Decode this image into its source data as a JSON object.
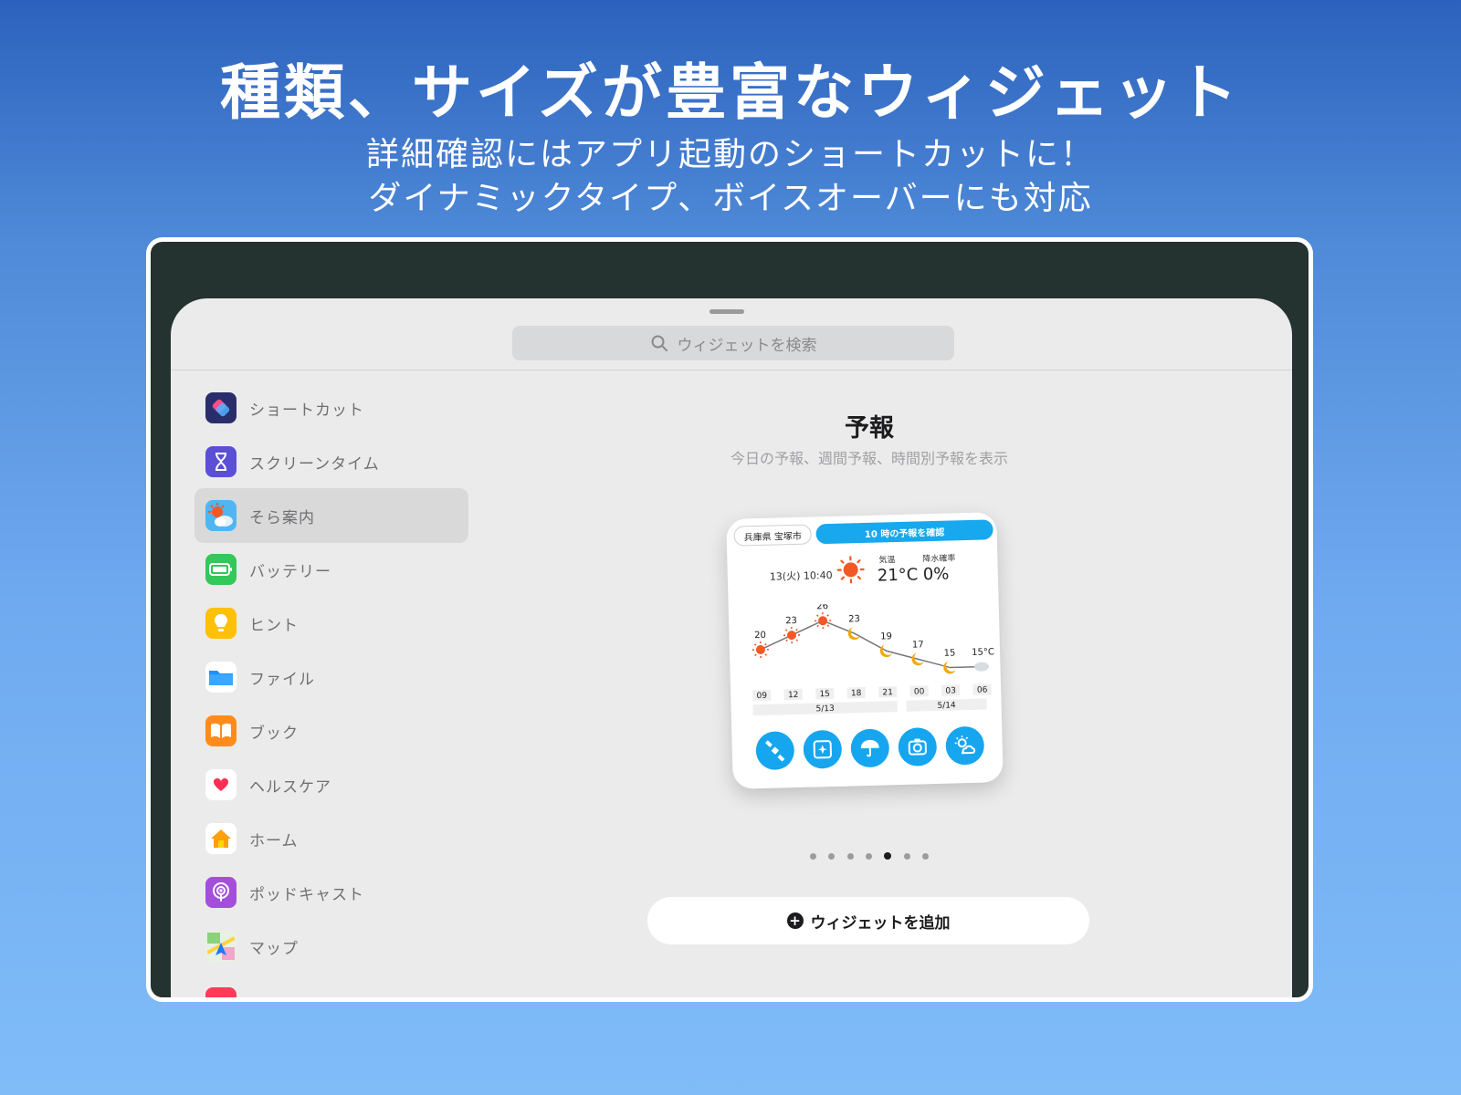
{
  "promo": {
    "headline": "種類、サイズが豊富なウィジェット",
    "subline1": "詳細確認にはアプリ起動のショートカットに！",
    "subline2": "ダイナミックタイプ、ボイスオーバーにも対応"
  },
  "search": {
    "placeholder": "ウィジェットを検索"
  },
  "sidebar": {
    "items": [
      {
        "label": "ショートカット",
        "icon": "shortcuts-icon"
      },
      {
        "label": "スクリーンタイム",
        "icon": "hourglass-icon"
      },
      {
        "label": "そら案内",
        "icon": "weather-app-icon",
        "selected": true
      },
      {
        "label": "バッテリー",
        "icon": "battery-icon"
      },
      {
        "label": "ヒント",
        "icon": "lightbulb-icon"
      },
      {
        "label": "ファイル",
        "icon": "folder-icon"
      },
      {
        "label": "ブック",
        "icon": "book-icon"
      },
      {
        "label": "ヘルスケア",
        "icon": "heart-icon"
      },
      {
        "label": "ホーム",
        "icon": "home-icon"
      },
      {
        "label": "ポッドキャスト",
        "icon": "podcast-icon"
      },
      {
        "label": "マップ",
        "icon": "maps-icon"
      }
    ]
  },
  "widget_gallery": {
    "title": "予報",
    "description": "今日の予報、週間予報、時間別予報を表示",
    "page_count": 7,
    "active_page": 5,
    "add_button": "ウィジェットを追加"
  },
  "widget": {
    "location": "兵庫県 宝塚市",
    "forecast_button": "10 時の予報を確認",
    "datetime": "13(火) 10:40",
    "temp_label": "気温",
    "temp_value": "21°C",
    "rain_label": "降水確率",
    "rain_value": "0%",
    "unit_label": "15°C",
    "hours": [
      "09",
      "12",
      "15",
      "18",
      "21",
      "00",
      "03",
      "06"
    ],
    "temps": [
      20,
      23,
      26,
      23,
      19,
      17,
      15,
      15
    ],
    "conditions": [
      "sun",
      "sun",
      "sun",
      "moon",
      "moon",
      "moon",
      "moon",
      "cloud"
    ],
    "dates": [
      "5/13",
      "5/14"
    ],
    "shortcut_icons": [
      "satellite-icon",
      "radar-map-icon",
      "umbrella-icon",
      "camera-icon",
      "sun-cloud-icon"
    ]
  },
  "colors": {
    "accent": "#16a6ef",
    "sun": "#f15a24",
    "moon": "#f5a800",
    "selected_row": "#d9d9da"
  }
}
